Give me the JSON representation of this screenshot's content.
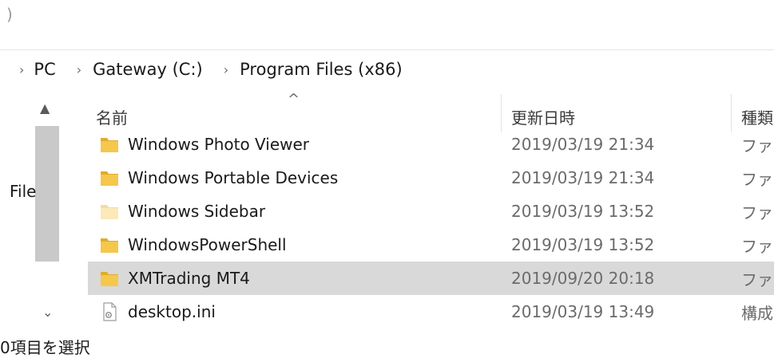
{
  "top_fragment": ")",
  "breadcrumb": {
    "items": [
      "PC",
      "Gateway (C:)",
      "Program Files (x86)"
    ]
  },
  "nav_pane": {
    "visible_text": "File"
  },
  "columns": {
    "name": "名前",
    "date": "更新日時",
    "type": "種類"
  },
  "rows": [
    {
      "name": "Windows Photo Viewer",
      "date": "2019/03/19 21:34",
      "type": "ファイ",
      "icon": "folder-icon",
      "selected": false
    },
    {
      "name": "Windows Portable Devices",
      "date": "2019/03/19 21:34",
      "type": "ファイ",
      "icon": "folder-icon",
      "selected": false
    },
    {
      "name": "Windows Sidebar",
      "date": "2019/03/19 13:52",
      "type": "ファイ",
      "icon": "folder-faded-icon",
      "selected": false
    },
    {
      "name": "WindowsPowerShell",
      "date": "2019/03/19 13:52",
      "type": "ファイ",
      "icon": "folder-icon",
      "selected": false
    },
    {
      "name": "XMTrading MT4",
      "date": "2019/09/20 20:18",
      "type": "ファイ",
      "icon": "folder-icon",
      "selected": true
    },
    {
      "name": "desktop.ini",
      "date": "2019/03/19 13:49",
      "type": "構成",
      "icon": "settings-file-icon",
      "selected": false
    }
  ],
  "status_bar": {
    "text": "0項目を選択"
  },
  "colors": {
    "folder": "#f5c84c",
    "folder_dark": "#e0ac2b",
    "folder_faded": "#fbe9b8",
    "selection": "#d9d9d9",
    "scroll_thumb": "#c9c9c9"
  }
}
